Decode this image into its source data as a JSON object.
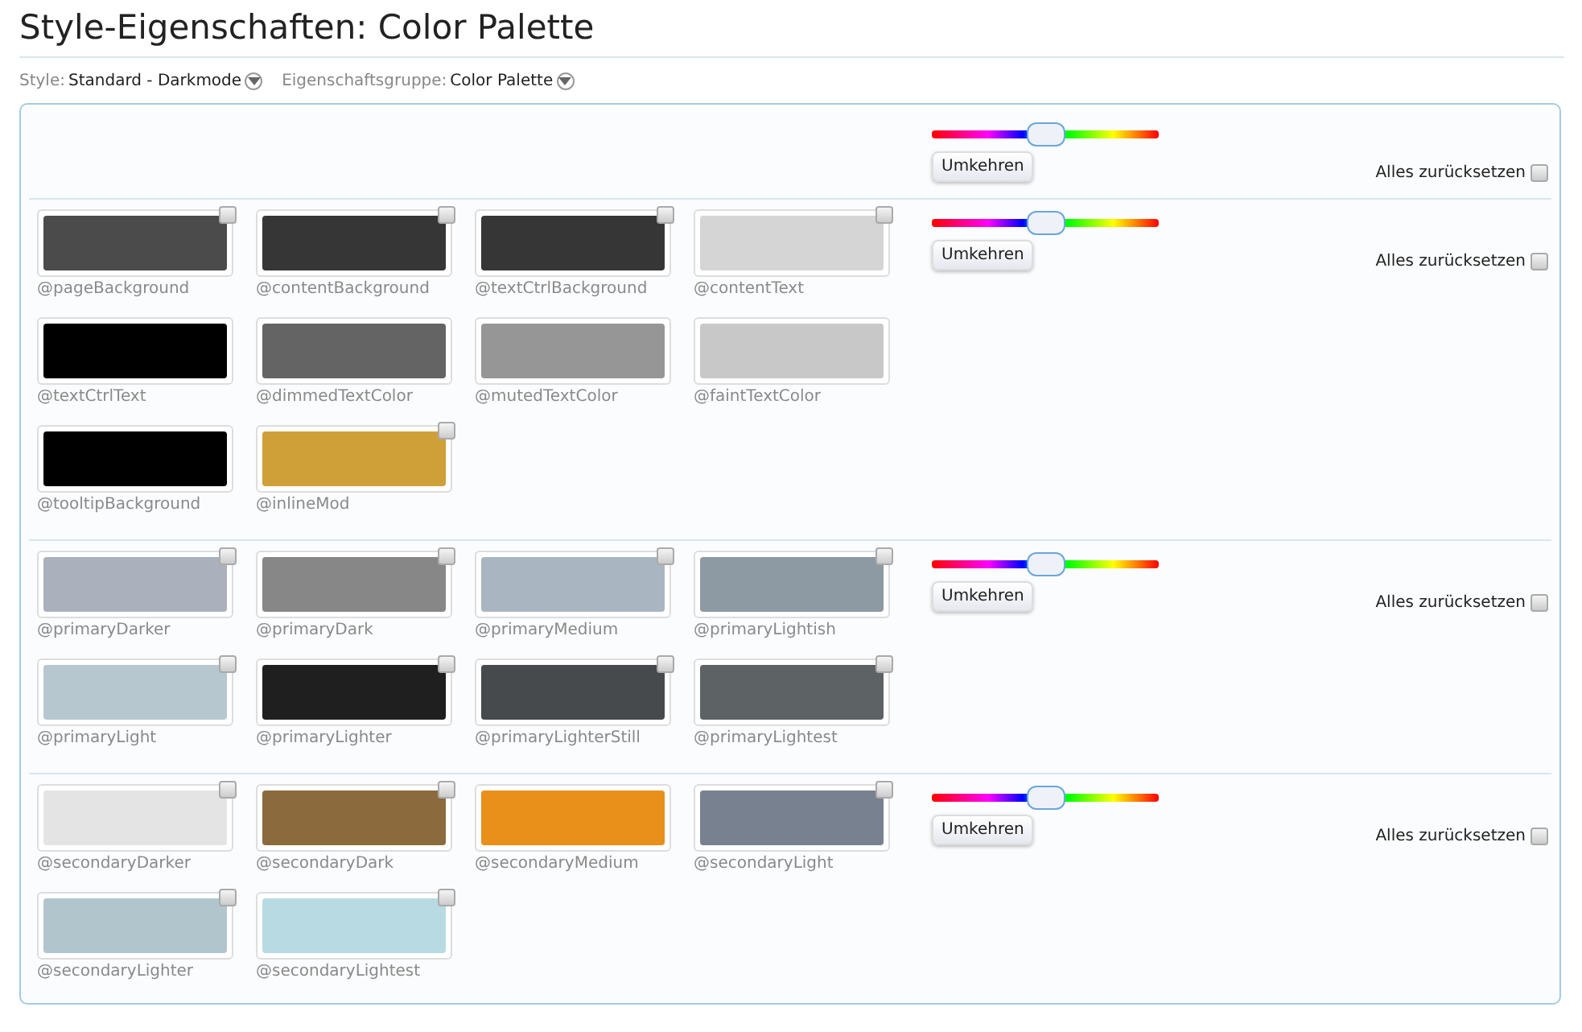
{
  "title": "Style-Eigenschaften: Color Palette",
  "filters": [
    {
      "label": "Style:",
      "value": "Standard - Darkmode"
    },
    {
      "label": "Eigenschaftsgruppe:",
      "value": "Color Palette"
    }
  ],
  "groups": [
    {
      "slider": {
        "level": 0.5
      },
      "button": "Umkehren",
      "reset": {
        "label": "Alles zurücksetzen",
        "checked": false
      }
    },
    {
      "slider": {
        "level": 0.5
      },
      "button": "Umkehren",
      "reset": {
        "label": "Alles zurücksetzen",
        "checked": false
      },
      "swatches": [
        {
          "name": "@pageBackground",
          "color": "#4b4b4b",
          "kind": "resettable",
          "checked": false
        },
        {
          "name": "@contentBackground",
          "color": "#363636",
          "kind": "resettable",
          "checked": false
        },
        {
          "name": "@textCtrlBackground",
          "color": "#363636",
          "kind": "resettable",
          "checked": false
        },
        {
          "name": "@contentText",
          "color": "#d5d5d5",
          "kind": "resettable",
          "checked": false
        },
        {
          "name": "@textCtrlText",
          "color": "#000000",
          "kind": "fixed"
        },
        {
          "name": "@dimmedTextColor",
          "color": "#646464",
          "kind": "fixed"
        },
        {
          "name": "@mutedTextColor",
          "color": "#969696",
          "kind": "fixed"
        },
        {
          "name": "@faintTextColor",
          "color": "#c8c8c8",
          "kind": "fixed"
        },
        {
          "name": "@tooltipBackground",
          "color": "#000000",
          "kind": "fixed"
        },
        {
          "name": "@inlineMod",
          "color": "#d0a038",
          "kind": "resettable",
          "checked": false
        }
      ]
    },
    {
      "slider": {
        "level": 0.5
      },
      "button": "Umkehren",
      "reset": {
        "label": "Alles zurücksetzen",
        "checked": false
      },
      "swatches": [
        {
          "name": "@primaryDarker",
          "color": "#aab0bc",
          "kind": "resettable",
          "checked": false
        },
        {
          "name": "@primaryDark",
          "color": "#878787",
          "kind": "resettable",
          "checked": false
        },
        {
          "name": "@primaryMedium",
          "color": "#a9b6c1",
          "kind": "resettable",
          "checked": false
        },
        {
          "name": "@primaryLightish",
          "color": "#8d99a3",
          "kind": "resettable",
          "checked": false
        },
        {
          "name": "@primaryLight",
          "color": "#b7c7d0",
          "kind": "resettable",
          "checked": false
        },
        {
          "name": "@primaryLighter",
          "color": "#1f1f1f",
          "kind": "resettable",
          "checked": false
        },
        {
          "name": "@primaryLighterStill",
          "color": "#464a4d",
          "kind": "resettable",
          "checked": false
        },
        {
          "name": "@primaryLightest",
          "color": "#5d6264",
          "kind": "resettable",
          "checked": false
        }
      ]
    },
    {
      "slider": {
        "level": 0.5
      },
      "button": "Umkehren",
      "reset": {
        "label": "Alles zurücksetzen",
        "checked": false
      },
      "swatches": [
        {
          "name": "@secondaryDarker",
          "color": "#e4e4e4",
          "kind": "resettable",
          "checked": false
        },
        {
          "name": "@secondaryDark",
          "color": "#8b6b3d",
          "kind": "resettable",
          "checked": false
        },
        {
          "name": "@secondaryMedium",
          "color": "#e8901a",
          "kind": "fixed"
        },
        {
          "name": "@secondaryLight",
          "color": "#788190",
          "kind": "resettable",
          "checked": false
        },
        {
          "name": "@secondaryLighter",
          "color": "#b1c6cc",
          "kind": "resettable",
          "checked": false
        },
        {
          "name": "@secondaryLightest",
          "color": "#b8dae3",
          "kind": "resettable",
          "checked": false
        }
      ]
    }
  ]
}
